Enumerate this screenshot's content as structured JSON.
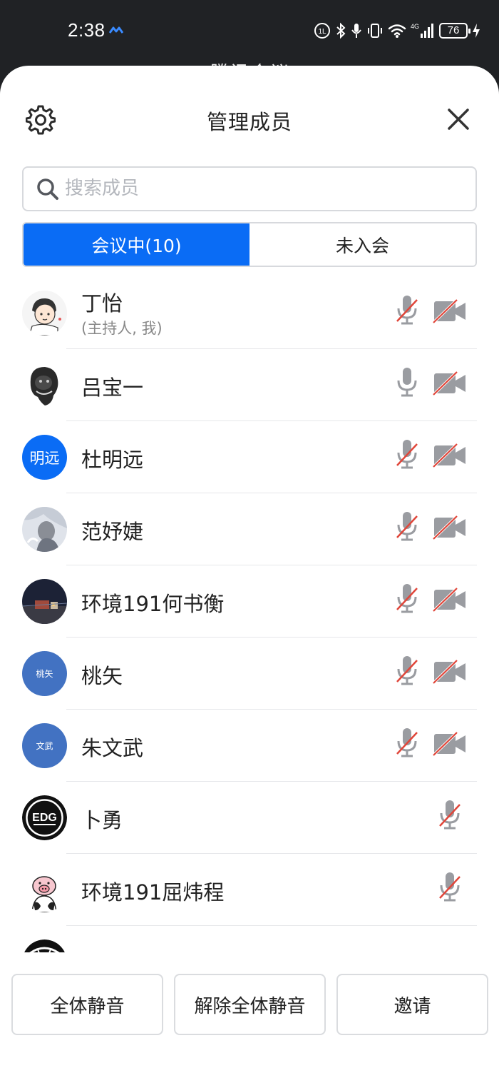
{
  "status_bar": {
    "time": "2:38",
    "network": "4G",
    "battery": "76"
  },
  "background_title": "腾讯会议",
  "header": {
    "title": "管理成员"
  },
  "search": {
    "placeholder": "搜索成员"
  },
  "tabs": [
    {
      "label": "会议中(10)",
      "active": true
    },
    {
      "label": "未入会",
      "active": false
    }
  ],
  "members": [
    {
      "name": "丁怡",
      "sub": "(主持人, 我)",
      "avatar": "cartoon-avatar",
      "mic": "muted",
      "camera": "off"
    },
    {
      "name": "吕宝一",
      "avatar": "photo-avatar",
      "mic": "on",
      "camera": "off"
    },
    {
      "name": "杜明远",
      "avatar_text": "明远",
      "mic": "muted",
      "camera": "off"
    },
    {
      "name": "范妤婕",
      "avatar": "photo-avatar",
      "mic": "muted",
      "camera": "off"
    },
    {
      "name": "环境191何书衡",
      "avatar": "photo-avatar",
      "mic": "muted",
      "camera": "off"
    },
    {
      "name": "桃矢",
      "avatar_text": "桃矢",
      "mic": "muted",
      "camera": "off"
    },
    {
      "name": "朱文武",
      "avatar_text": "文武",
      "mic": "muted",
      "camera": "off"
    },
    {
      "name": "卜勇",
      "avatar": "edg-logo-avatar",
      "mic": "muted"
    },
    {
      "name": "环境191屈炜程",
      "avatar": "pig-avatar",
      "mic": "muted"
    }
  ],
  "buttons": {
    "mute_all": "全体静音",
    "unmute_all": "解除全体静音",
    "invite": "邀请"
  },
  "colors": {
    "accent": "#0a6cf5",
    "muted_slash": "#e0463a",
    "icon_gray": "#9a9ca1"
  }
}
